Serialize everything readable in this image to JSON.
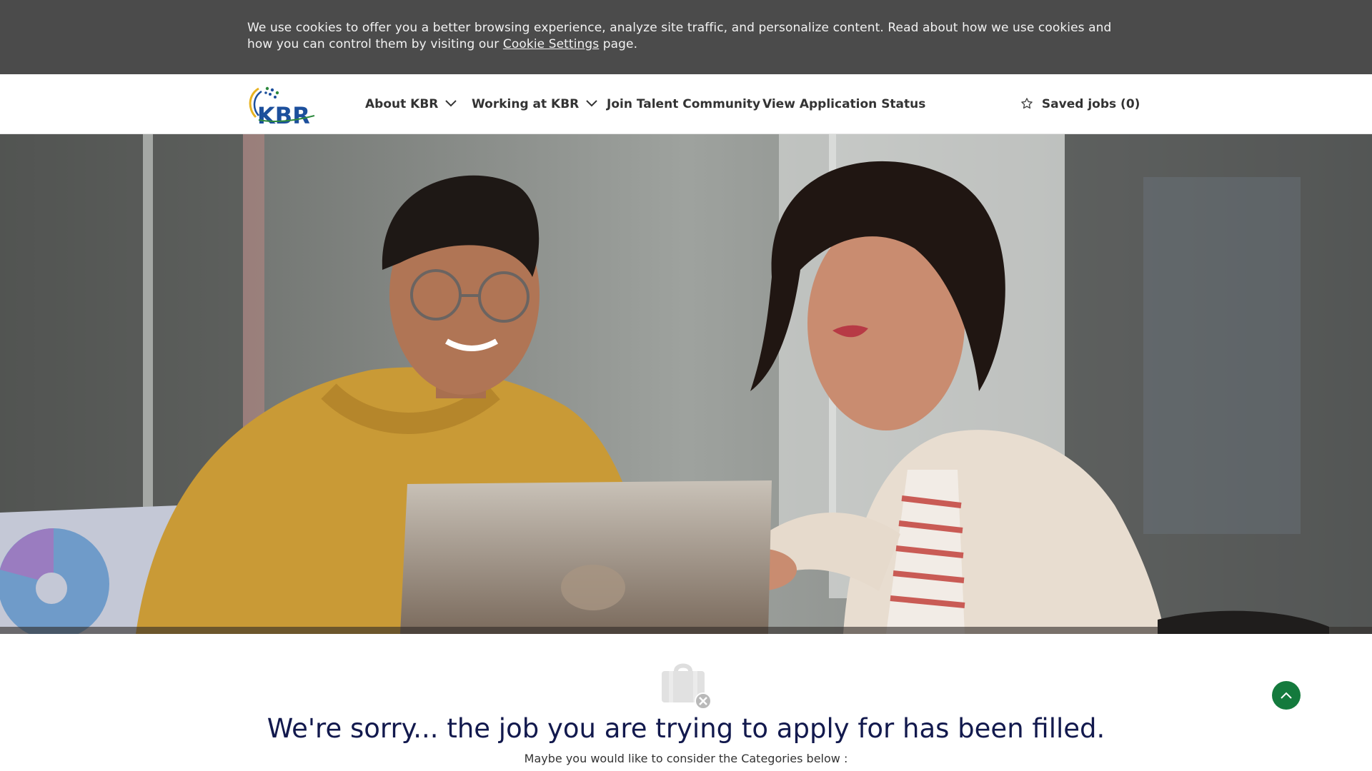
{
  "cookie_banner": {
    "text_before": "We use cookies to offer you a better browsing experience, analyze site traffic, and personalize content. Read about how we use cookies and how you can control them by visiting our ",
    "link_label": "Cookie Settings",
    "text_after": " page."
  },
  "header": {
    "logo_text": "KBR",
    "nav": [
      {
        "label": "About KBR",
        "has_dropdown": true,
        "icon": "chevron-down-icon"
      },
      {
        "label": "Working at KBR",
        "has_dropdown": true,
        "icon": "chevron-down-icon"
      },
      {
        "label": "Join Talent Community",
        "has_dropdown": false
      },
      {
        "label": "View Application Status",
        "has_dropdown": false
      }
    ],
    "saved_jobs_label": "Saved jobs (0)",
    "saved_jobs_icon": "star-outline-icon"
  },
  "hero": {
    "image": "two-women-looking-at-laptop-photo"
  },
  "content": {
    "status_icon": "job-bag-closed-icon",
    "title": "We're sorry... the job you are trying to apply for has been filled.",
    "subtitle": "Maybe you would like to consider the Categories below :"
  },
  "scroll_top": {
    "icon": "chevron-up-icon"
  },
  "colors": {
    "cookie_bg": "#4b4b4b",
    "title": "#12194d",
    "logo_blue": "#1c4f9c",
    "logo_green": "#2e8a3e",
    "scroll_button": "#147a3d"
  }
}
